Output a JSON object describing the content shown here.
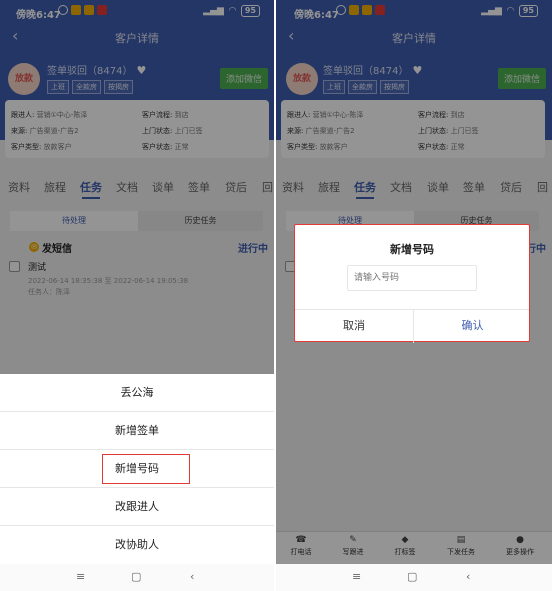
{
  "status_bar": {
    "time": "傍晚6:47",
    "battery": "95"
  },
  "header": {
    "title": "客户详情",
    "back": "‹"
  },
  "customer": {
    "avatar": "放款",
    "name": "签单驳回（8474）",
    "tags": [
      "上班",
      "全款房",
      "按揭房"
    ],
    "add_wechat": "添加微信"
  },
  "info": {
    "follower_label": "跟进人:",
    "follower": "营销①中心-陈泽",
    "process_label": "客户流程:",
    "process": "到店",
    "source_label": "来源:",
    "source": "广告渠道-广告2",
    "visit_label": "上门状态:",
    "visit": "上门已签",
    "type_label": "客户类型:",
    "type": "放款客户",
    "state_label": "客户状态:",
    "state": "正常"
  },
  "tabs": [
    "资料",
    "旅程",
    "任务",
    "文档",
    "谈单",
    "签单",
    "贷后",
    "回"
  ],
  "segment": {
    "pending": "待处理",
    "history": "历史任务"
  },
  "task": {
    "name": "发短信",
    "status": "进行中",
    "title": "测试",
    "time": "2022-06-14 18:35:38 至 2022-06-14 19:05:38",
    "person": "任务人：陈泽"
  },
  "action_sheet": [
    "丢公海",
    "新增签单",
    "新增号码",
    "改跟进人",
    "改协助人"
  ],
  "bottom_bar": [
    {
      "icon": "phone-icon",
      "glyph": "☎",
      "label": "打电话"
    },
    {
      "icon": "pen-icon",
      "glyph": "✎",
      "label": "写跟进"
    },
    {
      "icon": "tag-icon",
      "glyph": "◆",
      "label": "打标签"
    },
    {
      "icon": "task-icon",
      "glyph": "▤",
      "label": "下发任务"
    },
    {
      "icon": "more-icon",
      "glyph": "●",
      "label": "更多操作"
    }
  ],
  "dialog": {
    "title": "新增号码",
    "placeholder": "请输入号码",
    "cancel": "取消",
    "confirm": "确认"
  },
  "sysnav": {
    "menu": "≡",
    "home": "▢",
    "back": "‹"
  },
  "colors": {
    "primary": "#3f5eb0",
    "wechat": "#4caf50",
    "highlight": "#e53935"
  }
}
